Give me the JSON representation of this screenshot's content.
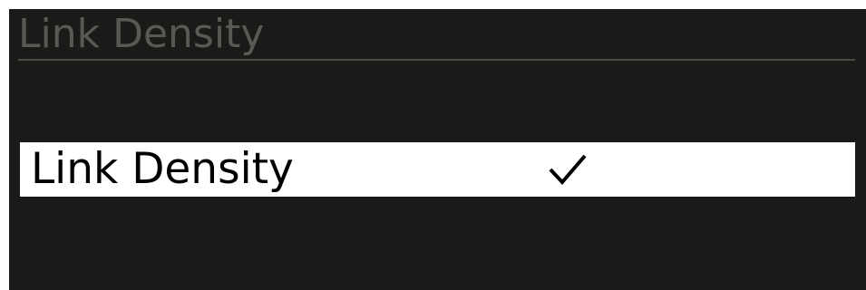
{
  "header": {
    "title": "Link Density"
  },
  "menu": {
    "items": [
      {
        "label": "Link Density",
        "selected": true,
        "icon": "checkmark-icon"
      }
    ]
  },
  "colors": {
    "background": "#1b1a19",
    "header_text": "#5a5854",
    "divider": "#4b4946",
    "selected_bg": "#ffffff",
    "selected_text": "#000000"
  }
}
